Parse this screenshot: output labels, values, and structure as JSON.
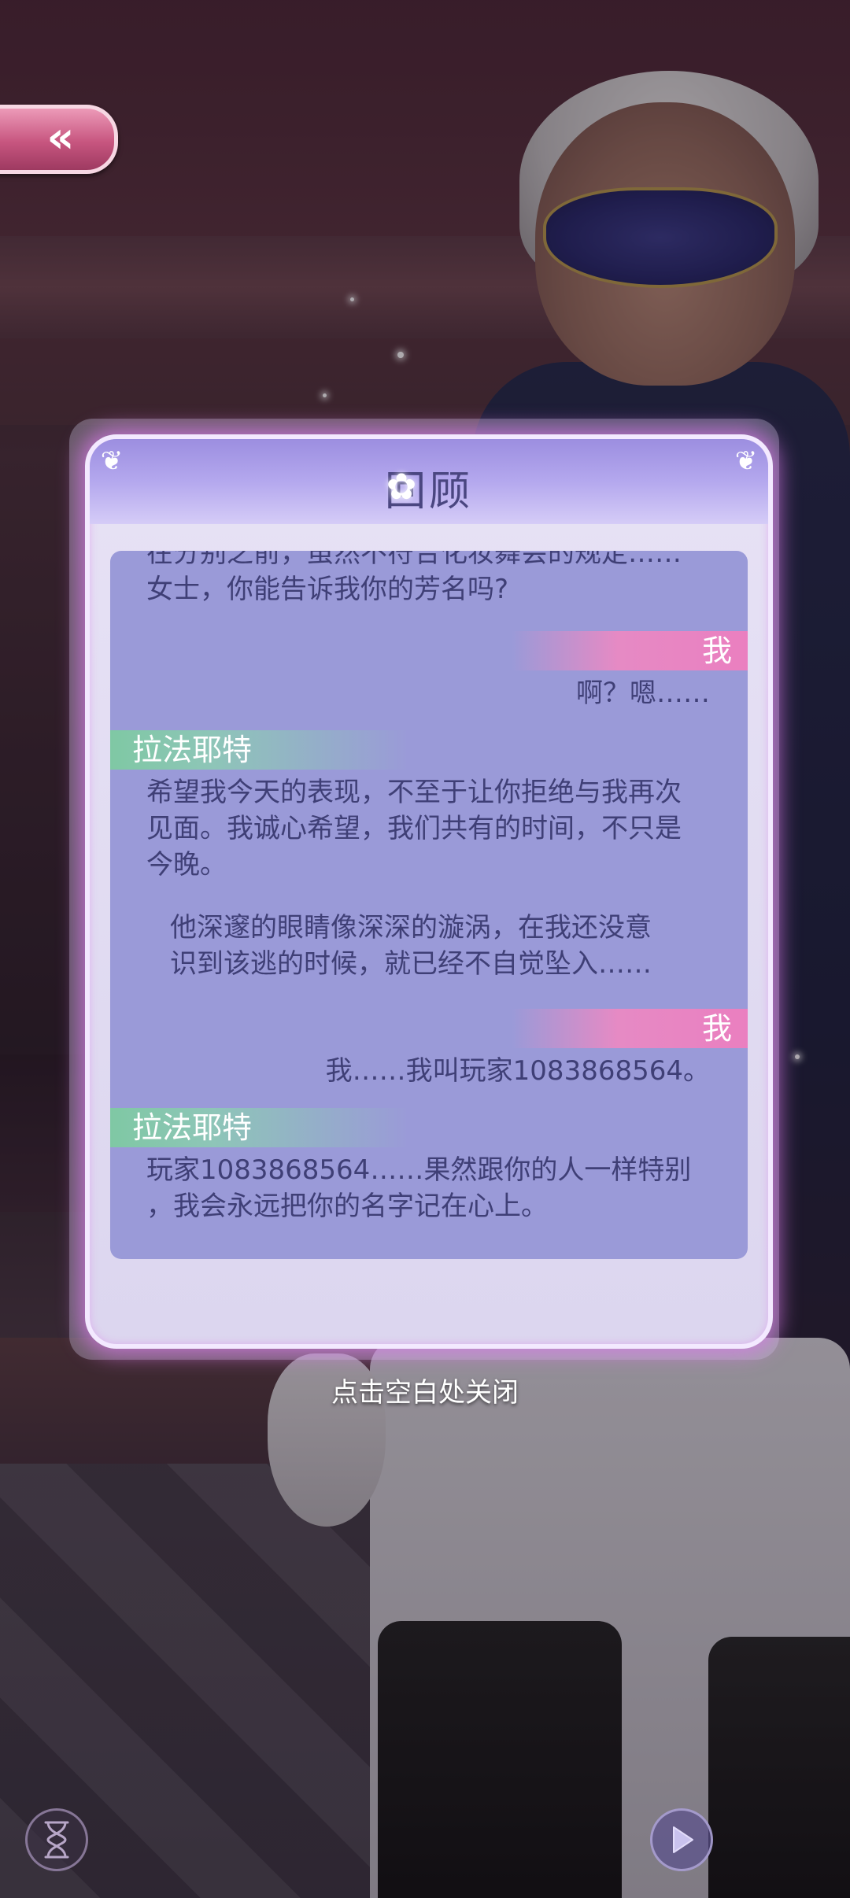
{
  "review_panel": {
    "title": "回顾",
    "entries": {
      "e0": {
        "type": "npc_continued",
        "lines": [
          "在分别之前，虽然不符合化妆舞会的规定……",
          "女士，你能告诉我你的芳名吗?"
        ]
      },
      "e1": {
        "type": "player",
        "speaker": "我",
        "text": "啊？嗯……"
      },
      "e2": {
        "type": "npc",
        "speaker": "拉法耶特",
        "lines": [
          "希望我今天的表现，不至于让你拒绝与我再次",
          "见面。我诚心希望，我们共有的时间，不只是",
          "今晚。"
        ]
      },
      "e3": {
        "type": "narration",
        "lines": [
          "他深邃的眼睛像深深的漩涡，在我还没意",
          "识到该逃的时候，就已经不自觉坠入……"
        ]
      },
      "e4": {
        "type": "player",
        "speaker": "我",
        "text": "我……我叫玩家1083868564。"
      },
      "e5": {
        "type": "npc",
        "speaker": "拉法耶特",
        "lines": [
          "玩家1083868564……果然跟你的人一样特别",
          "，我会永远把你的名字记在心上。"
        ]
      }
    }
  },
  "close_hint": "点击空白处关闭",
  "icons": {
    "back": "double-chevron-left-icon",
    "hourglass": "hourglass-icon",
    "play": "play-icon",
    "flower": "flower-icon"
  },
  "colors": {
    "npc_tag": "#7fc8a4",
    "player_tag": "#ea7fc0",
    "log_bg": "#9a9ad8",
    "log_text": "#3f3f76",
    "panel_glow": "#d678e6"
  }
}
